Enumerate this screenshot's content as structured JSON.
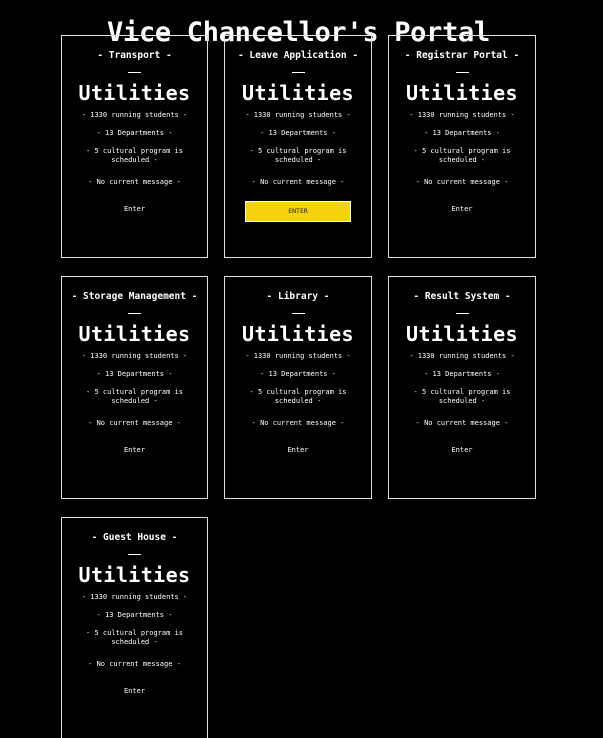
{
  "page": {
    "title": "Vice Chancellor's Portal"
  },
  "colors": {
    "background": "#000000",
    "text": "#ffffff",
    "accent_button": "#f5d20e"
  },
  "cards": [
    {
      "name": "- Transport -",
      "heading": "Utilities",
      "students": "- 1330 running students -",
      "departments": "- 13 Departments -",
      "cultural": "- 5 cultural program is scheduled -",
      "message": "- No current message -",
      "action": "Enter"
    },
    {
      "name": "- Leave Application -",
      "heading": "Utilities",
      "students": "- 1330 running students -",
      "departments": "- 13 Departments -",
      "cultural": "- 5 cultural program is scheduled -",
      "message": "- No current message -",
      "action": "ENTER"
    },
    {
      "name": "- Registrar Portal -",
      "heading": "Utilities",
      "students": "- 1330 running students -",
      "departments": "- 13 Departments -",
      "cultural": "- 5 cultural program is scheduled -",
      "message": "- No current message -",
      "action": "Enter"
    },
    {
      "name": "- Storage Management -",
      "heading": "Utilities",
      "students": "- 1330 running students -",
      "departments": "- 13 Departments -",
      "cultural": "- 5 cultural program is scheduled -",
      "message": "- No current message -",
      "action": "Enter"
    },
    {
      "name": "- Library -",
      "heading": "Utilities",
      "students": "- 1330 running students -",
      "departments": "- 13 Departments -",
      "cultural": "- 5 cultural program is scheduled -",
      "message": "- No current message -",
      "action": "Enter"
    },
    {
      "name": "- Result System -",
      "heading": "Utilities",
      "students": "- 1330 running students -",
      "departments": "- 13 Departments -",
      "cultural": "- 5 cultural program is scheduled -",
      "message": "- No current message -",
      "action": "Enter"
    },
    {
      "name": "- Guest House -",
      "heading": "Utilities",
      "students": "- 1330 running students -",
      "departments": "- 13 Departments -",
      "cultural": "- 5 cultural program is scheduled -",
      "message": "- No current message -",
      "action": "Enter"
    }
  ]
}
